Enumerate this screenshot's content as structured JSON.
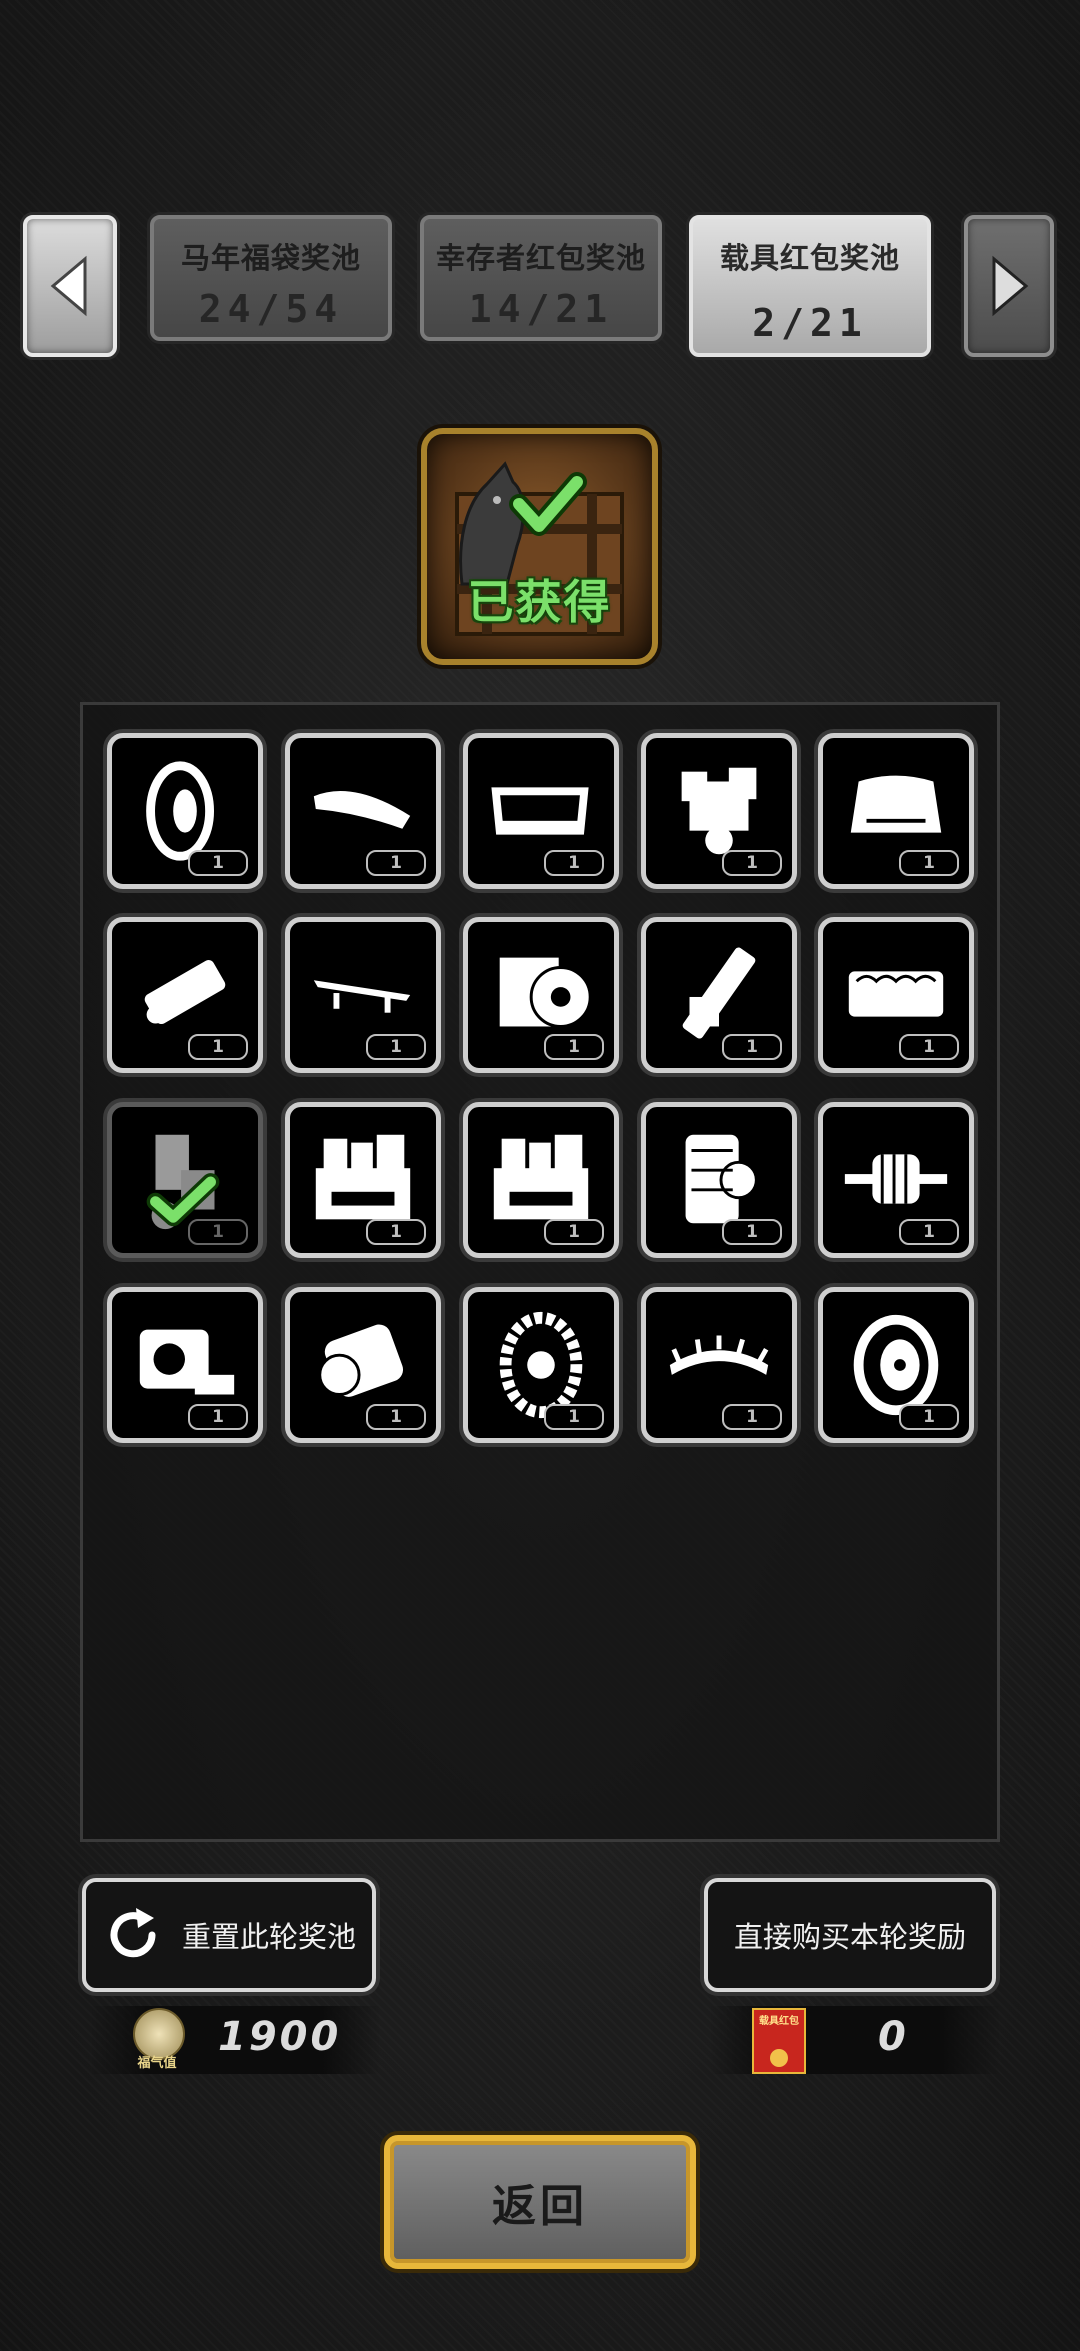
{
  "tabs": [
    {
      "title": "马年福袋奖池",
      "count": "24/54"
    },
    {
      "title": "幸存者红包奖池",
      "count": "14/21"
    },
    {
      "title": "载具红包奖池",
      "count": "2/21"
    }
  ],
  "active_tab": 2,
  "chest": {
    "status_label": "已获得"
  },
  "items": [
    {
      "icon": "tire-icon",
      "qty": "1",
      "collected": false
    },
    {
      "icon": "roof-box-icon",
      "qty": "1",
      "collected": false
    },
    {
      "icon": "roll-cage-icon",
      "qty": "1",
      "collected": false
    },
    {
      "icon": "v-engine-icon",
      "qty": "1",
      "collected": false
    },
    {
      "icon": "car-hood-icon",
      "qty": "1",
      "collected": false
    },
    {
      "icon": "axle-assembly-icon",
      "qty": "1",
      "collected": false
    },
    {
      "icon": "spoiler-icon",
      "qty": "1",
      "collected": false
    },
    {
      "icon": "engine-block-icon",
      "qty": "1",
      "collected": false
    },
    {
      "icon": "cylinder-icon",
      "qty": "1",
      "collected": false
    },
    {
      "icon": "inline-engine-icon",
      "qty": "1",
      "collected": false
    },
    {
      "icon": "motorcycle-engine-icon",
      "qty": "1",
      "collected": true
    },
    {
      "icon": "toolbox-icon",
      "qty": "1",
      "collected": false
    },
    {
      "icon": "toolbox-icon",
      "qty": "1",
      "collected": false
    },
    {
      "icon": "engine-cutaway-icon",
      "qty": "1",
      "collected": false
    },
    {
      "icon": "drive-shaft-icon",
      "qty": "1",
      "collected": false
    },
    {
      "icon": "turbo-engine-icon",
      "qty": "1",
      "collected": false
    },
    {
      "icon": "air-filter-icon",
      "qty": "1",
      "collected": false
    },
    {
      "icon": "chained-tire-icon",
      "qty": "1",
      "collected": false
    },
    {
      "icon": "spiked-bumper-icon",
      "qty": "1",
      "collected": false
    },
    {
      "icon": "sport-tire-icon",
      "qty": "1",
      "collected": false
    }
  ],
  "reset_button": {
    "label": "重置此轮奖池"
  },
  "buy_button": {
    "label": "直接购买本轮奖励"
  },
  "fortune": {
    "value": "1900",
    "icon_caption": "福气值"
  },
  "red_packet": {
    "value": "0",
    "icon_caption": "载具红包"
  },
  "back_button": {
    "label": "返回"
  },
  "colors": {
    "collected_check": "#7be06a",
    "chest_border": "#a8822c",
    "back_border": "#e8b73a"
  }
}
